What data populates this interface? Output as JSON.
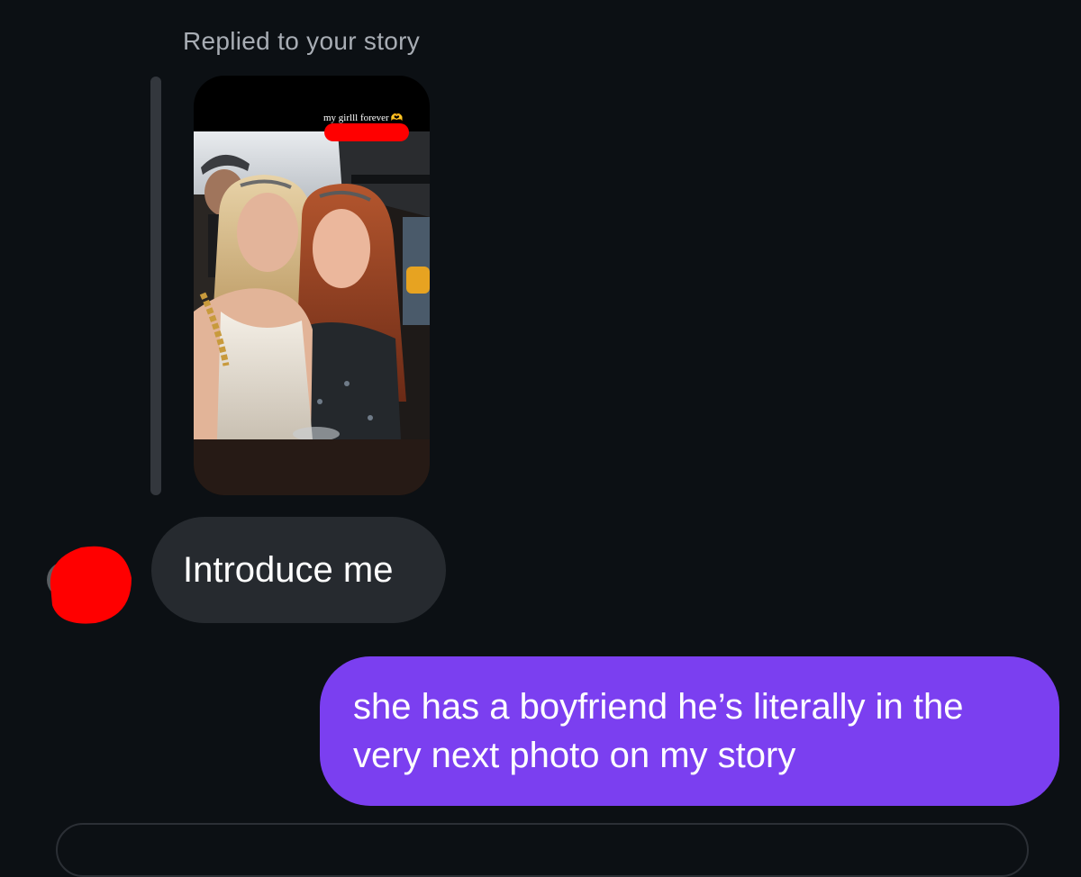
{
  "thread": {
    "reply_context": "Replied to your story",
    "story": {
      "caption": "my girlll forever",
      "caption_emoji": "🫶"
    }
  },
  "messages": [
    {
      "direction": "received",
      "text": "Introduce me"
    },
    {
      "direction": "sent",
      "text": "she has a boyfriend he’s literally in the very next photo on my story"
    }
  ],
  "colors": {
    "background": "#0c1014",
    "received_bubble": "#262a2f",
    "sent_bubble": "#7b3ff0",
    "redaction": "#ff0000",
    "reply_label": "#a8adb4"
  }
}
